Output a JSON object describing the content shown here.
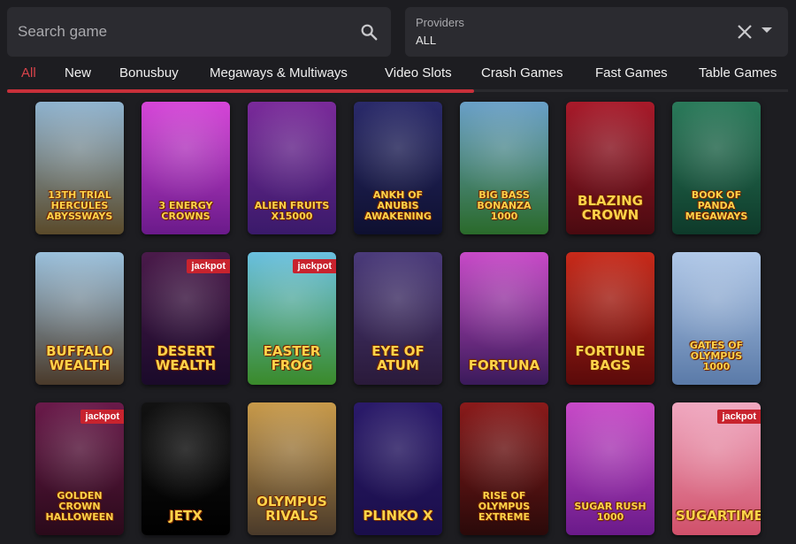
{
  "search": {
    "placeholder": "Search game"
  },
  "providers": {
    "label": "Providers",
    "value": "ALL"
  },
  "tabs": [
    {
      "label": "All",
      "active": true
    },
    {
      "label": "New"
    },
    {
      "label": "Bonusbuy"
    },
    {
      "label": "Megaways & Multiways"
    },
    {
      "label": "Video Slots"
    },
    {
      "label": "Crash Games"
    },
    {
      "label": "Fast Games"
    },
    {
      "label": "Table Games"
    }
  ],
  "colors": {
    "accent": "#c8303a",
    "background": "#1d1d21",
    "field": "#2b2b30",
    "jackpot": "#c8232e"
  },
  "games": [
    {
      "title": "13th Trial Hercules Abyssways",
      "art_top": "#8fb3cf",
      "art_bottom": "#5a4a2a",
      "jackpot": false
    },
    {
      "title": "3 Energy Crowns",
      "art_top": "#d646d8",
      "art_bottom": "#6a1a8a",
      "jackpot": false
    },
    {
      "title": "Alien Fruits x15000",
      "art_top": "#7a2a9a",
      "art_bottom": "#3a1a6a",
      "jackpot": false
    },
    {
      "title": "Ankh of Anubis Awakening",
      "art_top": "#2a2a6a",
      "art_bottom": "#0e1030",
      "jackpot": false
    },
    {
      "title": "Big Bass Bonanza 1000",
      "art_top": "#6aa0c8",
      "art_bottom": "#2a6a2a",
      "jackpot": false
    },
    {
      "title": "Blazing Crown",
      "art_top": "#a81a2a",
      "art_bottom": "#4a0a10",
      "jackpot": false
    },
    {
      "title": "Book of Panda Megaways",
      "art_top": "#2a7a5a",
      "art_bottom": "#0e3a2a",
      "jackpot": false
    },
    {
      "title": "Buffalo Wealth",
      "art_top": "#9ac0dc",
      "art_bottom": "#4a3a2a",
      "jackpot": false
    },
    {
      "title": "Desert Wealth",
      "art_top": "#4a1a4a",
      "art_bottom": "#1a0a2a",
      "jackpot": true,
      "jackpot_label": "jackpot"
    },
    {
      "title": "Easter Frog",
      "art_top": "#6ac0e0",
      "art_bottom": "#3a8a2a",
      "jackpot": true,
      "jackpot_label": "jackpot"
    },
    {
      "title": "Eye of Atum",
      "art_top": "#4a3a7a",
      "art_bottom": "#2a1a3a",
      "jackpot": false
    },
    {
      "title": "Fortuna",
      "art_top": "#c84ac8",
      "art_bottom": "#3a1a5a",
      "jackpot": false
    },
    {
      "title": "Fortune Bags",
      "art_top": "#c82a1a",
      "art_bottom": "#5a0a0a",
      "jackpot": false
    },
    {
      "title": "Gates of Olympus 1000",
      "art_top": "#b0c8e8",
      "art_bottom": "#5a7aa8",
      "jackpot": false
    },
    {
      "title": "Golden Crown Halloween",
      "art_top": "#6a1a4a",
      "art_bottom": "#2a0a1a",
      "jackpot": true,
      "jackpot_label": "jackpot"
    },
    {
      "title": "JetX",
      "art_top": "#121212",
      "art_bottom": "#000000",
      "jackpot": false
    },
    {
      "title": "Olympus Rivals",
      "art_top": "#c89a4a",
      "art_bottom": "#4a3a2a",
      "jackpot": false
    },
    {
      "title": "plinko x",
      "art_top": "#2a1a6a",
      "art_bottom": "#1a0e4a",
      "jackpot": false
    },
    {
      "title": "Rise of Olympus Extreme",
      "art_top": "#8a1a1a",
      "art_bottom": "#2a0a0a",
      "jackpot": false
    },
    {
      "title": "Sugar Rush 1000",
      "art_top": "#c84ac8",
      "art_bottom": "#6a1a8a",
      "jackpot": false
    },
    {
      "title": "Sugartime",
      "art_top": "#f0a8c0",
      "art_bottom": "#d0506a",
      "jackpot": true,
      "jackpot_label": "jackpot"
    }
  ]
}
